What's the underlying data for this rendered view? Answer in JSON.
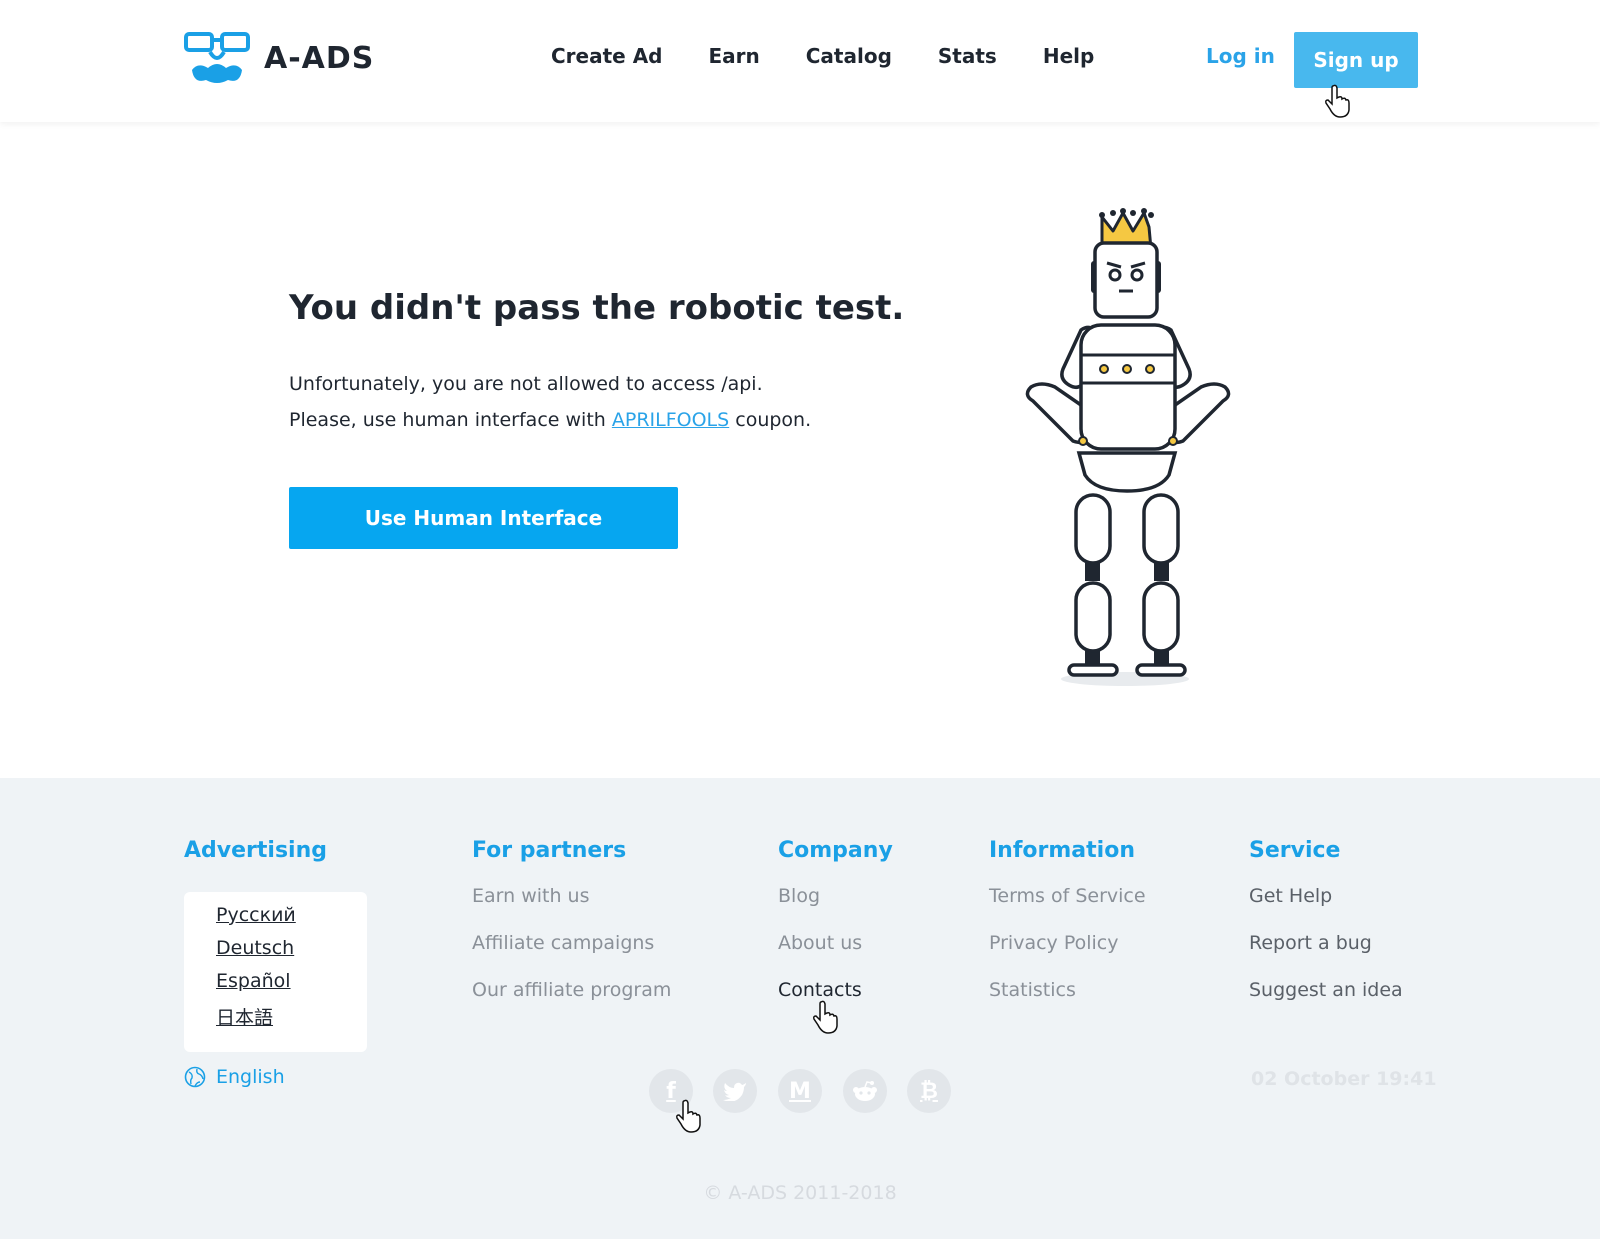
{
  "header": {
    "logo_text": "A-ADS",
    "nav": [
      "Create Ad",
      "Earn",
      "Catalog",
      "Stats",
      "Help"
    ],
    "login_label": "Log in",
    "signup_label": "Sign up"
  },
  "main": {
    "title": "You didn't pass the robotic test.",
    "line1": "Unfortunately, you are not allowed to access /api.",
    "line2_prefix": "Please, use human interface with ",
    "coupon": "APRILFOOLS",
    "line2_suffix": " coupon.",
    "button_label": "Use Human Interface"
  },
  "footer": {
    "advertising": {
      "heading": "Advertising",
      "languages": [
        "Русский",
        "Deutsch",
        "Español",
        "日本語"
      ],
      "current_language": "English"
    },
    "partners": {
      "heading": "For partners",
      "links": [
        "Earn with us",
        "Affiliate campaigns",
        "Our affiliate program"
      ]
    },
    "company": {
      "heading": "Company",
      "links": [
        "Blog",
        "About us",
        "Contacts"
      ]
    },
    "information": {
      "heading": "Information",
      "links": [
        "Terms of Service",
        "Privacy Policy",
        "Statistics"
      ]
    },
    "service": {
      "heading": "Service",
      "links": [
        "Get Help",
        "Report a bug",
        "Suggest an idea"
      ]
    },
    "social_icons": [
      "facebook-icon",
      "twitter-icon",
      "medium-icon",
      "reddit-icon",
      "bitcoin-icon"
    ],
    "social_glyphs": [
      "f",
      "",
      "M",
      "",
      "₿"
    ],
    "datetime": "02 October 19:41",
    "copyright": "© A-ADS 2011-2018"
  },
  "colors": {
    "accent": "#06a6f0",
    "link": "#2aa3e8",
    "heading_blue": "#1aa0e6",
    "signup_bg": "#48b8ee",
    "footer_bg": "#eff3f6",
    "crown": "#f5c842"
  }
}
